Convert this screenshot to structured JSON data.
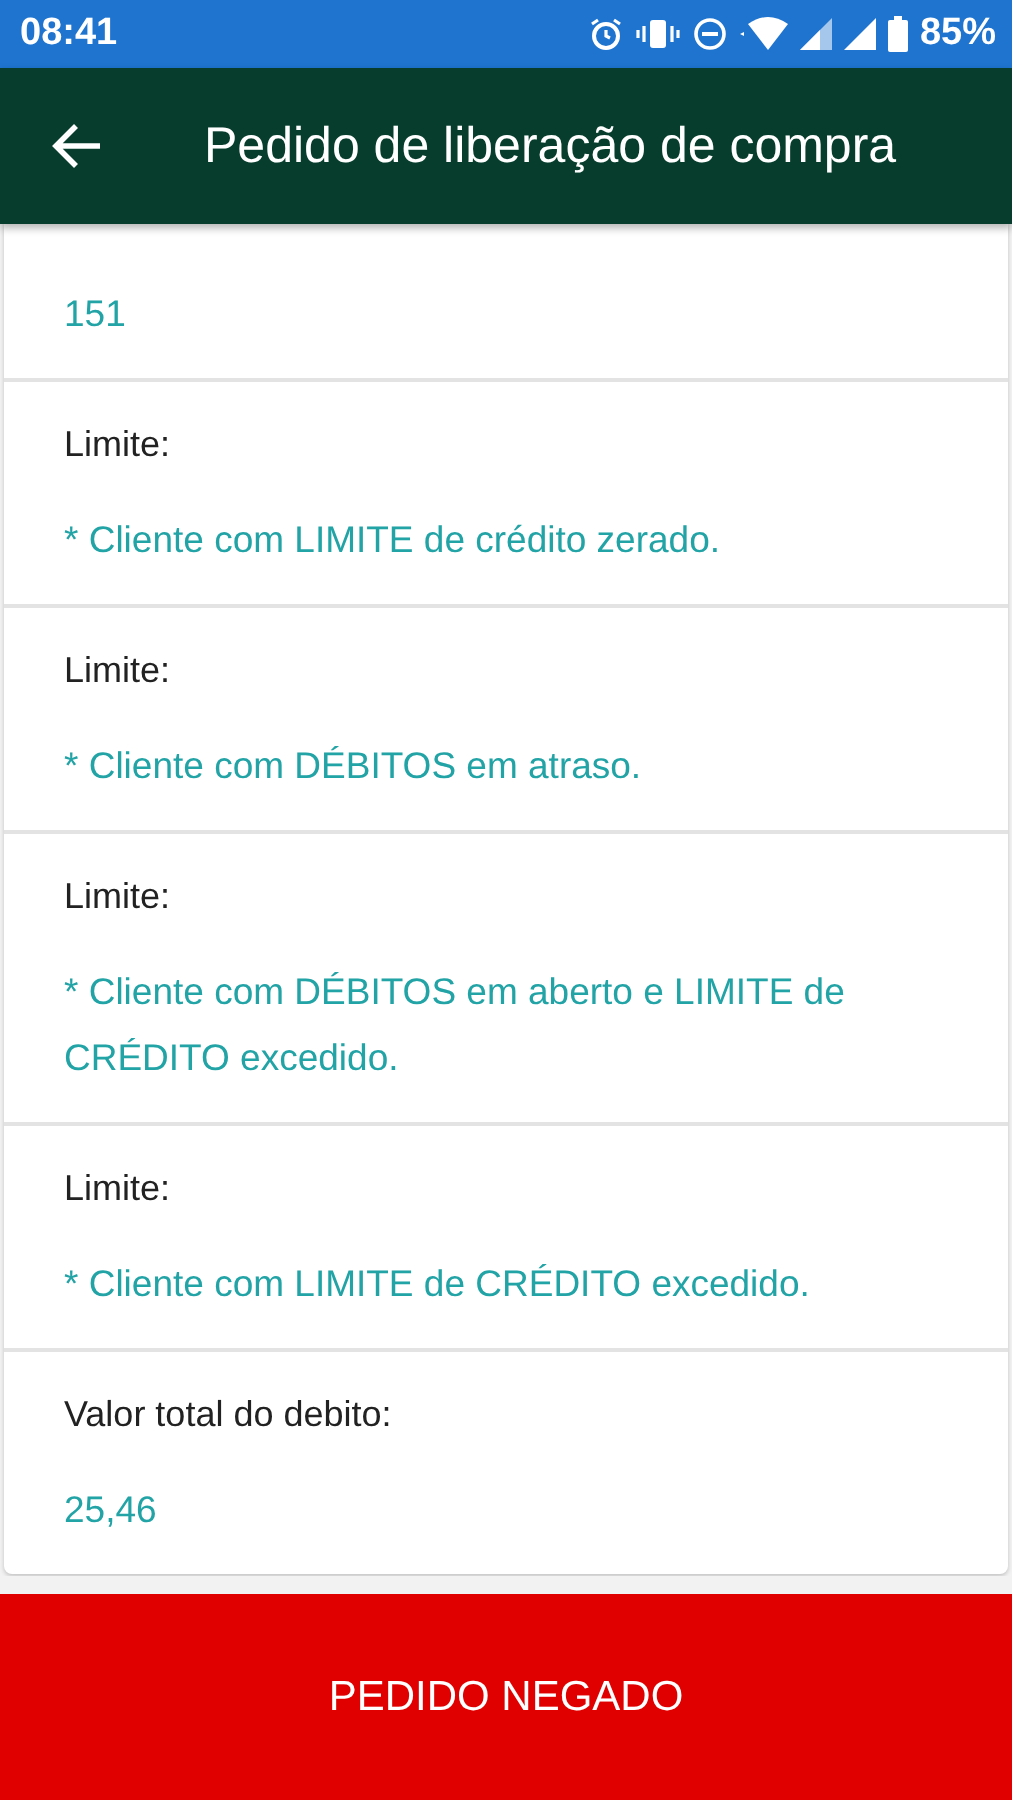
{
  "status_bar": {
    "time": "08:41",
    "battery": "85%"
  },
  "app_bar": {
    "title": "Pedido de liberação de compra"
  },
  "fields": [
    {
      "value": "151"
    },
    {
      "label": "Limite:",
      "value": "* Cliente com LIMITE de crédito zerado."
    },
    {
      "label": "Limite:",
      "value": "* Cliente com DÉBITOS em atraso."
    },
    {
      "label": "Limite:",
      "value": "* Cliente com DÉBITOS em aberto e LIMITE de CRÉDITO excedido."
    },
    {
      "label": "Limite:",
      "value": "* Cliente com LIMITE de CRÉDITO excedido."
    },
    {
      "label": "Valor total do debito:",
      "value": "25,46"
    }
  ],
  "action_button": {
    "label": "PEDIDO NEGADO"
  }
}
